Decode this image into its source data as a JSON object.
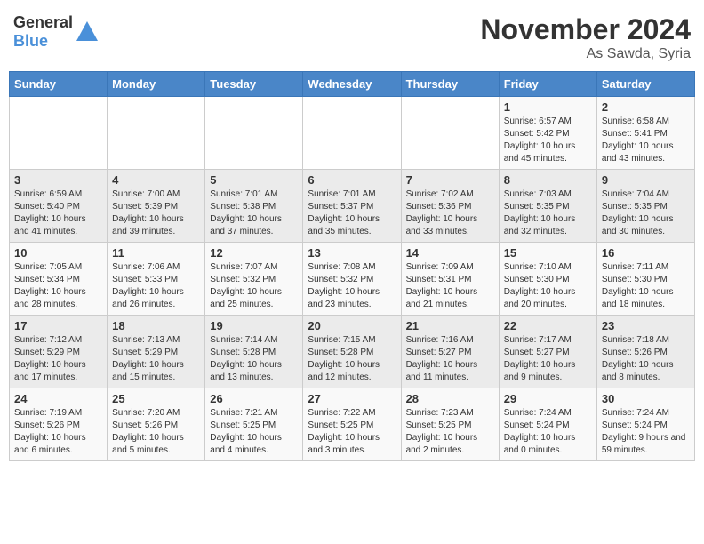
{
  "header": {
    "logo_general": "General",
    "logo_blue": "Blue",
    "month": "November 2024",
    "location": "As Sawda, Syria"
  },
  "days_of_week": [
    "Sunday",
    "Monday",
    "Tuesday",
    "Wednesday",
    "Thursday",
    "Friday",
    "Saturday"
  ],
  "weeks": [
    [
      {
        "day": "",
        "content": ""
      },
      {
        "day": "",
        "content": ""
      },
      {
        "day": "",
        "content": ""
      },
      {
        "day": "",
        "content": ""
      },
      {
        "day": "",
        "content": ""
      },
      {
        "day": "1",
        "content": "Sunrise: 6:57 AM\nSunset: 5:42 PM\nDaylight: 10 hours\nand 45 minutes."
      },
      {
        "day": "2",
        "content": "Sunrise: 6:58 AM\nSunset: 5:41 PM\nDaylight: 10 hours\nand 43 minutes."
      }
    ],
    [
      {
        "day": "3",
        "content": "Sunrise: 6:59 AM\nSunset: 5:40 PM\nDaylight: 10 hours\nand 41 minutes."
      },
      {
        "day": "4",
        "content": "Sunrise: 7:00 AM\nSunset: 5:39 PM\nDaylight: 10 hours\nand 39 minutes."
      },
      {
        "day": "5",
        "content": "Sunrise: 7:01 AM\nSunset: 5:38 PM\nDaylight: 10 hours\nand 37 minutes."
      },
      {
        "day": "6",
        "content": "Sunrise: 7:01 AM\nSunset: 5:37 PM\nDaylight: 10 hours\nand 35 minutes."
      },
      {
        "day": "7",
        "content": "Sunrise: 7:02 AM\nSunset: 5:36 PM\nDaylight: 10 hours\nand 33 minutes."
      },
      {
        "day": "8",
        "content": "Sunrise: 7:03 AM\nSunset: 5:35 PM\nDaylight: 10 hours\nand 32 minutes."
      },
      {
        "day": "9",
        "content": "Sunrise: 7:04 AM\nSunset: 5:35 PM\nDaylight: 10 hours\nand 30 minutes."
      }
    ],
    [
      {
        "day": "10",
        "content": "Sunrise: 7:05 AM\nSunset: 5:34 PM\nDaylight: 10 hours\nand 28 minutes."
      },
      {
        "day": "11",
        "content": "Sunrise: 7:06 AM\nSunset: 5:33 PM\nDaylight: 10 hours\nand 26 minutes."
      },
      {
        "day": "12",
        "content": "Sunrise: 7:07 AM\nSunset: 5:32 PM\nDaylight: 10 hours\nand 25 minutes."
      },
      {
        "day": "13",
        "content": "Sunrise: 7:08 AM\nSunset: 5:32 PM\nDaylight: 10 hours\nand 23 minutes."
      },
      {
        "day": "14",
        "content": "Sunrise: 7:09 AM\nSunset: 5:31 PM\nDaylight: 10 hours\nand 21 minutes."
      },
      {
        "day": "15",
        "content": "Sunrise: 7:10 AM\nSunset: 5:30 PM\nDaylight: 10 hours\nand 20 minutes."
      },
      {
        "day": "16",
        "content": "Sunrise: 7:11 AM\nSunset: 5:30 PM\nDaylight: 10 hours\nand 18 minutes."
      }
    ],
    [
      {
        "day": "17",
        "content": "Sunrise: 7:12 AM\nSunset: 5:29 PM\nDaylight: 10 hours\nand 17 minutes."
      },
      {
        "day": "18",
        "content": "Sunrise: 7:13 AM\nSunset: 5:29 PM\nDaylight: 10 hours\nand 15 minutes."
      },
      {
        "day": "19",
        "content": "Sunrise: 7:14 AM\nSunset: 5:28 PM\nDaylight: 10 hours\nand 13 minutes."
      },
      {
        "day": "20",
        "content": "Sunrise: 7:15 AM\nSunset: 5:28 PM\nDaylight: 10 hours\nand 12 minutes."
      },
      {
        "day": "21",
        "content": "Sunrise: 7:16 AM\nSunset: 5:27 PM\nDaylight: 10 hours\nand 11 minutes."
      },
      {
        "day": "22",
        "content": "Sunrise: 7:17 AM\nSunset: 5:27 PM\nDaylight: 10 hours\nand 9 minutes."
      },
      {
        "day": "23",
        "content": "Sunrise: 7:18 AM\nSunset: 5:26 PM\nDaylight: 10 hours\nand 8 minutes."
      }
    ],
    [
      {
        "day": "24",
        "content": "Sunrise: 7:19 AM\nSunset: 5:26 PM\nDaylight: 10 hours\nand 6 minutes."
      },
      {
        "day": "25",
        "content": "Sunrise: 7:20 AM\nSunset: 5:26 PM\nDaylight: 10 hours\nand 5 minutes."
      },
      {
        "day": "26",
        "content": "Sunrise: 7:21 AM\nSunset: 5:25 PM\nDaylight: 10 hours\nand 4 minutes."
      },
      {
        "day": "27",
        "content": "Sunrise: 7:22 AM\nSunset: 5:25 PM\nDaylight: 10 hours\nand 3 minutes."
      },
      {
        "day": "28",
        "content": "Sunrise: 7:23 AM\nSunset: 5:25 PM\nDaylight: 10 hours\nand 2 minutes."
      },
      {
        "day": "29",
        "content": "Sunrise: 7:24 AM\nSunset: 5:24 PM\nDaylight: 10 hours\nand 0 minutes."
      },
      {
        "day": "30",
        "content": "Sunrise: 7:24 AM\nSunset: 5:24 PM\nDaylight: 9 hours\nand 59 minutes."
      }
    ]
  ]
}
